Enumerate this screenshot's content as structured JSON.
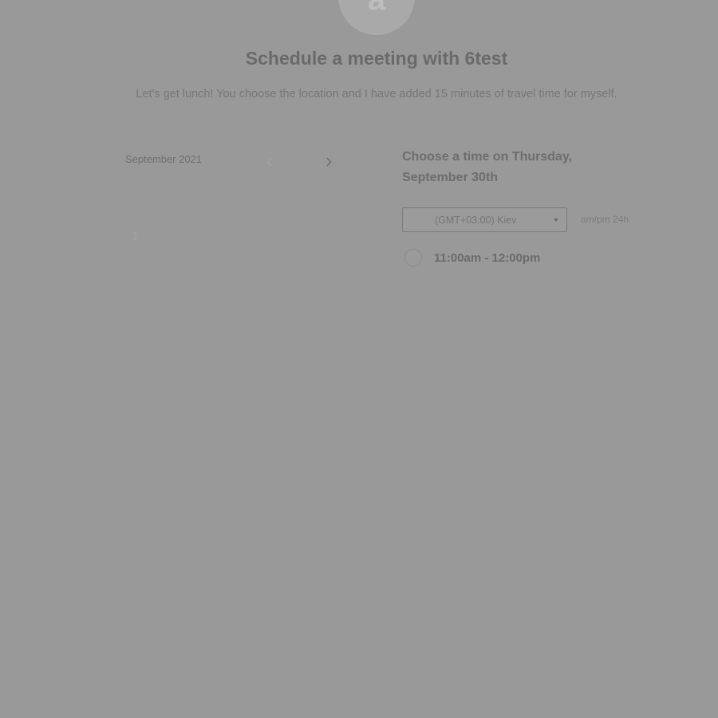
{
  "host": {
    "avatar_initial": "a"
  },
  "header": {
    "title": "Schedule a meeting with 6test",
    "description": "Let's get lunch! You choose the location and I have added 15 minutes of travel time for myself."
  },
  "calendar": {
    "month_label": "September 2021",
    "weekdays": [
      "",
      "",
      "",
      "",
      "",
      "",
      ""
    ],
    "days": [
      "1",
      "",
      "",
      "",
      "",
      "",
      "",
      "",
      "",
      "",
      "",
      "",
      "",
      "",
      "",
      "",
      "",
      "",
      "",
      "",
      ""
    ]
  },
  "times": {
    "heading": "Choose a time on Thursday, September 30th",
    "timezone": "(GMT+03:00) Kiev",
    "format_12h": "am/pm",
    "format_24h": "24h",
    "slots": [
      {
        "label": "11:00am - 12:00pm"
      }
    ]
  },
  "colors": {
    "overlay": "#999999"
  }
}
